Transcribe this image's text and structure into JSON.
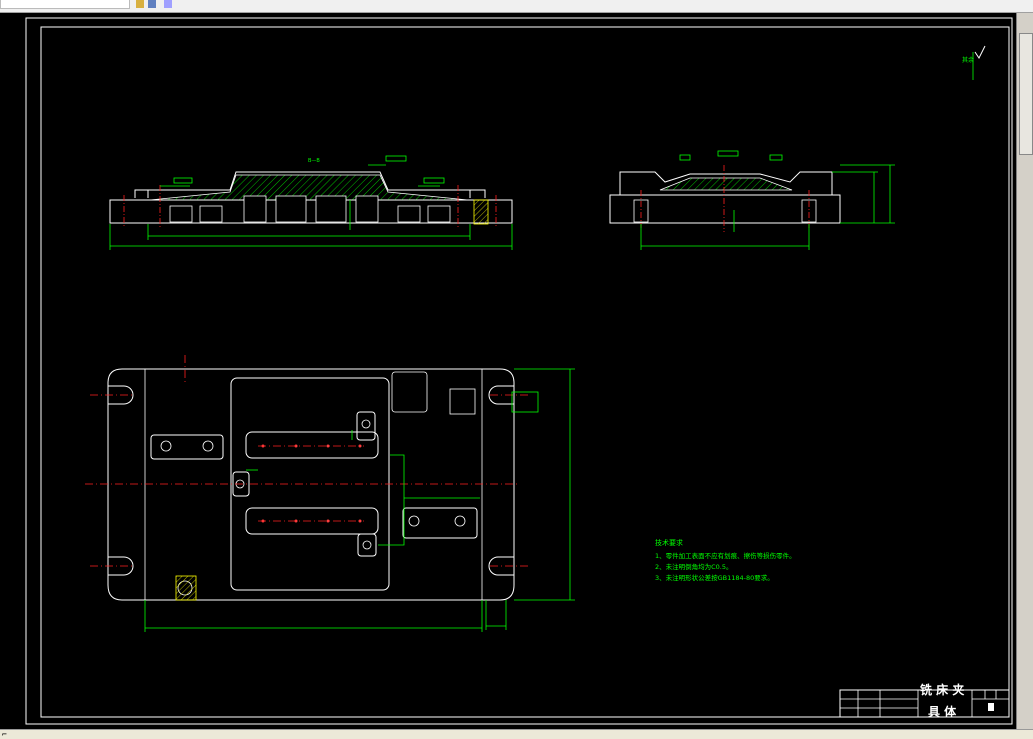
{
  "drawing": {
    "notes_title": "技术要求",
    "notes": [
      "1、零件加工表面不应有划痕、擦伤等损伤零件。",
      "2、未注明倒角均为C0.5。",
      "3、未注明形状公差按GB1184-80要求。"
    ],
    "title_block": {
      "name_line1": "铣 床 夹",
      "name_line2": "具 体"
    },
    "roughness_mark": "其余"
  },
  "colors": {
    "background": "#000000",
    "outline": "#ffffff",
    "dimension": "#00ff00",
    "centerline": "#ff2020"
  }
}
